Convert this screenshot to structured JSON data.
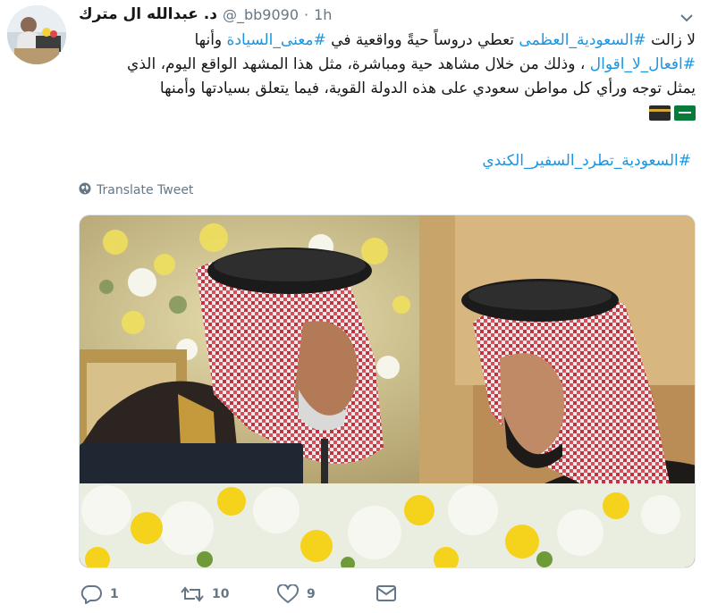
{
  "tweet": {
    "display_name": "د. عبدالله ال مترك",
    "handle": "@_bb9090",
    "separator": "·",
    "time": "1h",
    "text_lines": {
      "l1_pre": "لا زالت ",
      "l1_tag1": "#السعودية_العظمى",
      "l1_mid": " تعطي دروساً حيةً وواقعية في ",
      "l1_tag2": "#معنى_السيادة",
      "l1_post": " وأنها",
      "l2_tag": "#افعال_لا_اقوال",
      "l2_post": " ، وذلك من خلال مشاهد حية ومباشرة، مثل هذا المشهد الواقع اليوم، الذي",
      "l3": "يمثل توجه ورأي كل مواطن سعودي على هذه الدولة القوية، فيما يتعلق بسيادتها وأمنها"
    },
    "hashtag_line": "#السعودية_تطرد_السفير_الكندي",
    "translate_label": "Translate Tweet",
    "actions": {
      "reply_count": "1",
      "retweet_count": "10",
      "like_count": "9"
    }
  },
  "icons": {
    "caret": "chevron-down-icon",
    "globe": "globe-icon",
    "reply": "reply-icon",
    "retweet": "retweet-icon",
    "like": "heart-icon",
    "dm": "envelope-icon"
  },
  "colors": {
    "link": "#1b95e0",
    "muted": "#657786",
    "text": "#14171a"
  }
}
